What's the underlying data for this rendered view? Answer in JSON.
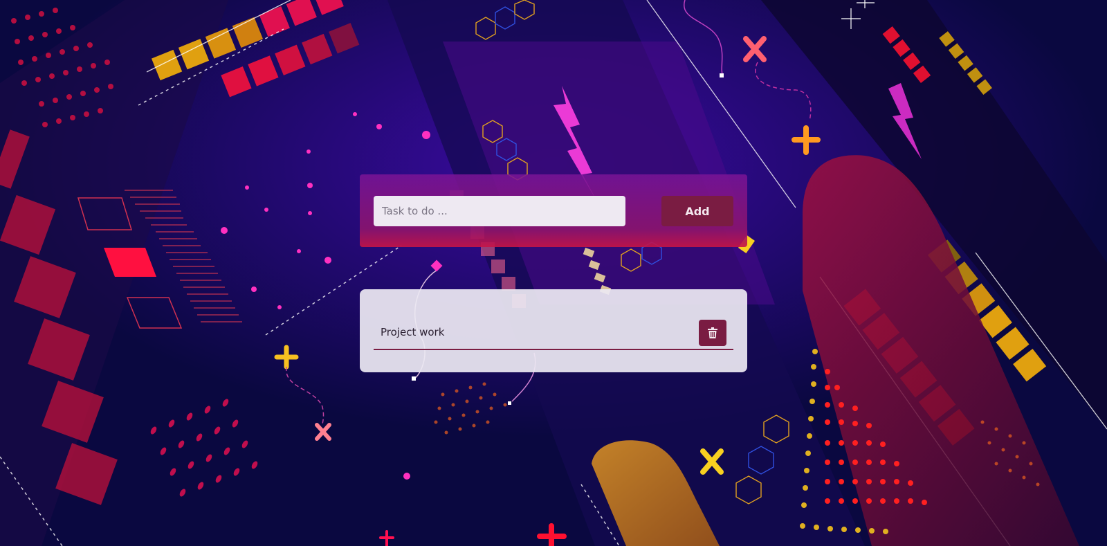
{
  "new_task": {
    "placeholder": "Task to do ...",
    "value": "",
    "add_label": "Add"
  },
  "todo_list": {
    "items": [
      {
        "text": "Project work",
        "delete_icon": "trash-icon"
      }
    ]
  },
  "colors": {
    "accent": "#7a1c42",
    "card_background": "#ece8f2",
    "input_panel": "#8a1a8f"
  }
}
